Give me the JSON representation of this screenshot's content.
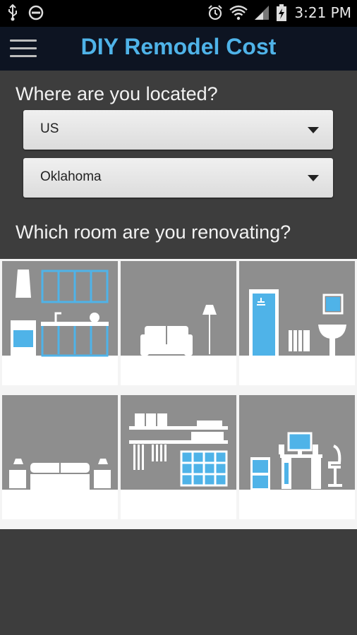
{
  "status_bar": {
    "time": "3:21 PM",
    "icons": [
      "usb-icon",
      "do-not-disturb-icon",
      "alarm-icon",
      "wifi-icon",
      "signal-icon",
      "battery-charging-icon"
    ]
  },
  "app_bar": {
    "title": "DIY Remodel Cost",
    "menu_icon": "hamburger-menu-icon"
  },
  "location": {
    "question": "Where are you located?",
    "country": {
      "selected": "US"
    },
    "region": {
      "selected": "Oklahoma"
    }
  },
  "rooms": {
    "question": "Which room are you renovating?",
    "tiles": [
      {
        "name": "kitchen"
      },
      {
        "name": "living-room"
      },
      {
        "name": "bathroom"
      },
      {
        "name": "bedroom"
      },
      {
        "name": "laundry-storage"
      },
      {
        "name": "office"
      }
    ]
  },
  "colors": {
    "accent": "#4fb3e8",
    "app_bar": "#0d1422",
    "background": "#3d3d3d",
    "tile": "#8e8e8e"
  }
}
